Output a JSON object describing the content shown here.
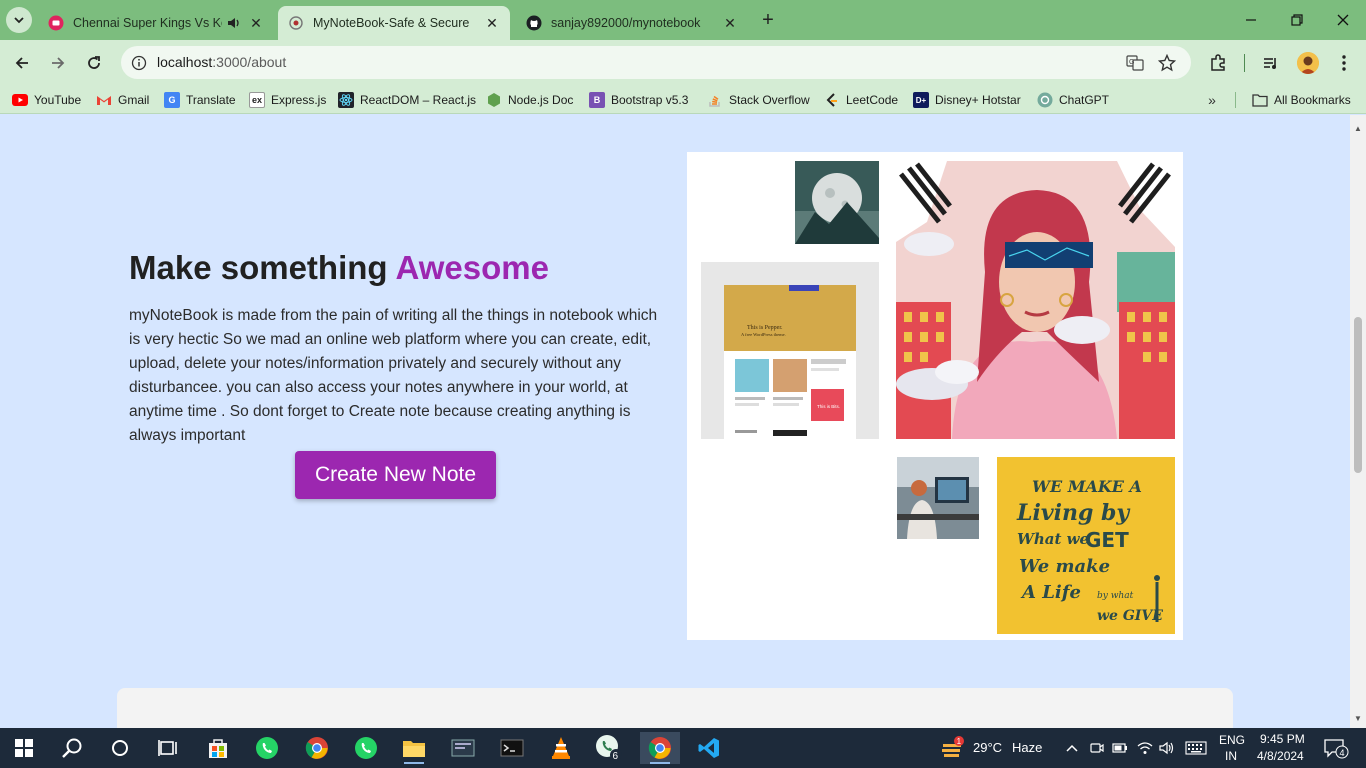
{
  "browser": {
    "tabs": [
      {
        "title": "Chennai Super Kings Vs Kolkata",
        "icon": "youtube-live-icon",
        "audio": true,
        "active": false
      },
      {
        "title": "MyNoteBook-Safe & Secure",
        "icon": "page-icon",
        "active": true
      },
      {
        "title": "sanjay892000/mynotebook",
        "icon": "github-icon",
        "active": false
      }
    ],
    "new_tab_label": "+",
    "address": {
      "host": "localhost",
      "path": ":3000/about"
    },
    "bookmarks": [
      {
        "label": "YouTube",
        "icon": "youtube-icon",
        "color": "#ff0000"
      },
      {
        "label": "Gmail",
        "icon": "gmail-icon",
        "color": "#ea4335"
      },
      {
        "label": "Translate",
        "icon": "translate-icon",
        "color": "#4285f4"
      },
      {
        "label": "Express.js",
        "icon": "express-icon",
        "color": "#222222"
      },
      {
        "label": "ReactDOM – React.js",
        "icon": "react-icon",
        "color": "#20232a"
      },
      {
        "label": "Node.js Doc",
        "icon": "nodejs-icon",
        "color": "#5fa04e"
      },
      {
        "label": "Bootstrap v5.3",
        "icon": "bootstrap-icon",
        "color": "#7952b3"
      },
      {
        "label": "Stack Overflow",
        "icon": "stackoverflow-icon",
        "color": "#f48024"
      },
      {
        "label": "LeetCode",
        "icon": "leetcode-icon",
        "color": "#ffa116"
      },
      {
        "label": "Disney+ Hotstar",
        "icon": "hotstar-icon",
        "color": "#0f1b5c"
      },
      {
        "label": "ChatGPT",
        "icon": "chatgpt-icon",
        "color": "#74aa9c"
      }
    ],
    "all_bookmarks_label": "All Bookmarks"
  },
  "page": {
    "headline_main": "Make something ",
    "headline_accent": "Awesome",
    "description": "myNoteBook is made from the pain of writing all the things in notebook which is very hectic So we mad an online web platform where you can create, edit, upload, delete your notes/information privately and securely without any disturbancee. you can also access your notes anywhere in your world, at anytime time . So dont forget to Create note because creating anything is always important",
    "cta_label": "Create New Note",
    "accent_color": "#9c27b0",
    "collage": {
      "mockup_title": "This is Pepper.",
      "mockup_subtitle": "A free WordPress theme.",
      "mockup_badge": "This is Bits.",
      "poster_lines": [
        "WE MAKE A",
        "Living by",
        "What we",
        "GET",
        "We make",
        "A Life",
        "by what",
        "we GIVE"
      ]
    }
  },
  "taskbar": {
    "weather_temp": "29°C",
    "weather_desc": "Haze",
    "weather_badge": "1",
    "lang_top": "ENG",
    "lang_bottom": "IN",
    "time": "9:45 PM",
    "date": "4/8/2024",
    "notification_count": "4",
    "whatsapp_badge": "6"
  }
}
